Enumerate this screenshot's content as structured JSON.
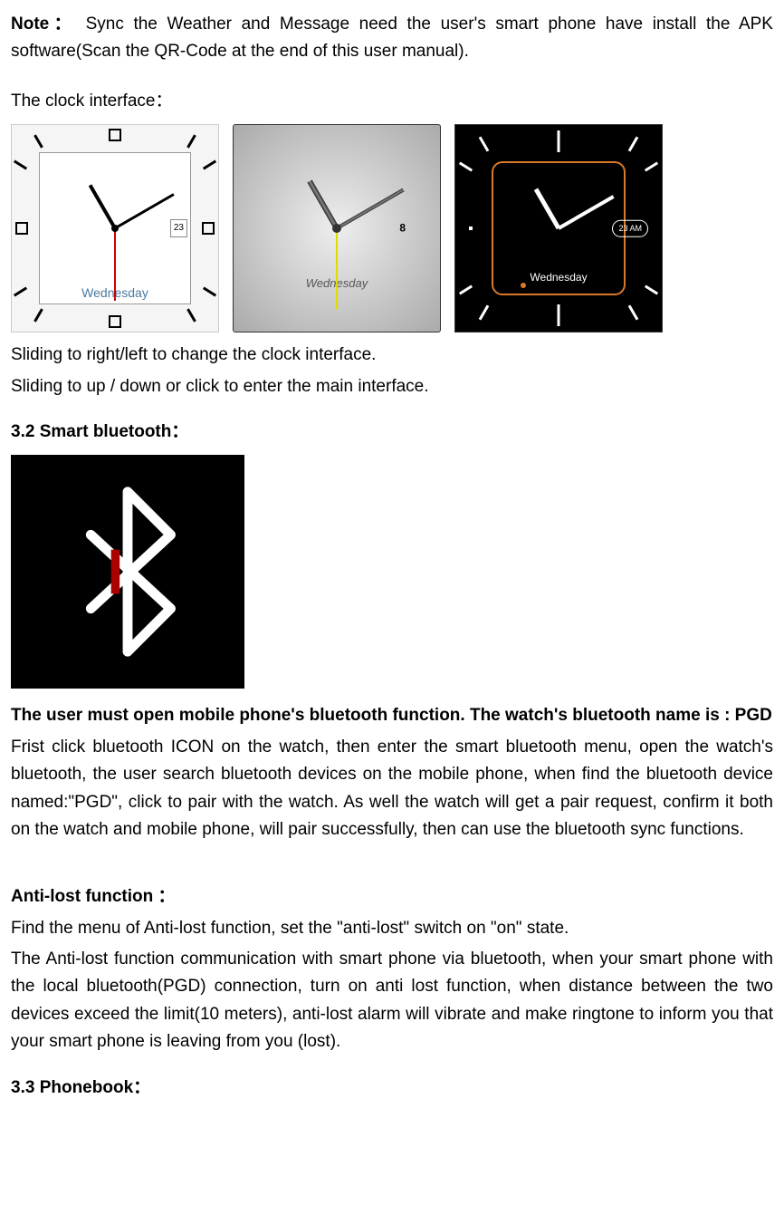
{
  "note": {
    "label": "Note：",
    "text": "Sync the Weather and Message need the user's smart phone have install the APK software(Scan the QR-Code at the end of this user manual)."
  },
  "clock_section": {
    "title": "The clock interface：",
    "face1_day": "Wednesday",
    "face1_date": "23",
    "face2_day": "Wednesday",
    "face2_date": "8",
    "face3_day": "Wednesday",
    "face3_date": "23  AM",
    "instruction1": "Sliding to right/left to change the clock interface.",
    "instruction2": "Sliding to up / down or click to enter the main interface."
  },
  "bluetooth_section": {
    "title": "3.2 Smart bluetooth：",
    "intro_bold": "The user must open mobile phone's bluetooth function. The watch's bluetooth name is : PGD",
    "body": "Frist click bluetooth ICON on the watch, then enter the smart bluetooth menu, open the watch's bluetooth, the user search bluetooth devices on the mobile phone, when find the bluetooth device named:\"PGD\", click to pair with the watch. As well the watch will get a pair request, confirm it both on the watch and mobile phone, will pair successfully, then can use the bluetooth sync functions."
  },
  "antilost_section": {
    "title": "Anti-lost function ：",
    "line1": "Find the menu of Anti-lost function, set the \"anti-lost\" switch on \"on\" state.",
    "body": "The Anti-lost function communication with smart phone via bluetooth, when your smart phone with the local bluetooth(PGD) connection, turn on anti lost function, when distance between the two devices exceed the limit(10 meters), anti-lost alarm will vibrate and make ringtone to inform you that your smart phone is leaving from you (lost)."
  },
  "phonebook_section": {
    "title": "3.3 Phonebook："
  }
}
